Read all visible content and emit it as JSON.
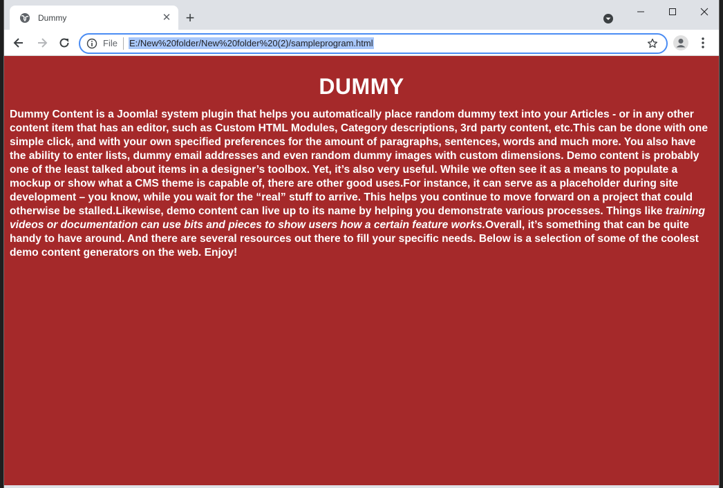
{
  "browser": {
    "tab": {
      "title": "Dummy",
      "close_icon": "close-icon",
      "favicon": "globe-icon"
    },
    "new_tab_label": "+",
    "omnibox": {
      "scheme_label": "File",
      "url": "E:/New%20folder/New%20folder%20(2)/sampleprogram.html",
      "url_selected": true
    },
    "colors": {
      "accent": "#4a8cf3",
      "selection": "#a8c7fa"
    }
  },
  "page": {
    "background": "#a5292a",
    "heading": "DUMMY",
    "paragraph": {
      "text_before": "Dummy Content is a Joomla! system plugin that helps you automatically place random dummy text into your Articles - or in any other content item that has an editor, such as Custom HTML Modules, Category descriptions, 3rd party content, etc.This can be done with one simple click, and with your own specified preferences for the amount of paragraphs, sentences, words and much more. You also have the ability to enter lists, dummy email addresses and even random dummy images with custom dimensions. Demo content is probably one of the least talked about items in a designer’s toolbox. Yet, it’s also very useful. While we often see it as a means to populate a mockup or show what a CMS theme is capable of, there are other good uses.For instance, it can serve as a placeholder during site development – you know, while you wait for the “real” stuff to arrive. This helps you continue to move forward on a project that could otherwise be stalled.Likewise, demo content can live up to its name by helping you demonstrate various processes. Things like ",
      "text_italic": "training videos or documentation can use bits and pieces to show users how a certain feature works.",
      "text_after": "Overall, it’s something that can be quite handy to have around. And there are several resources out there to fill your specific needs. Below is a selection of some of the coolest demo content generators on the web. Enjoy!"
    }
  }
}
